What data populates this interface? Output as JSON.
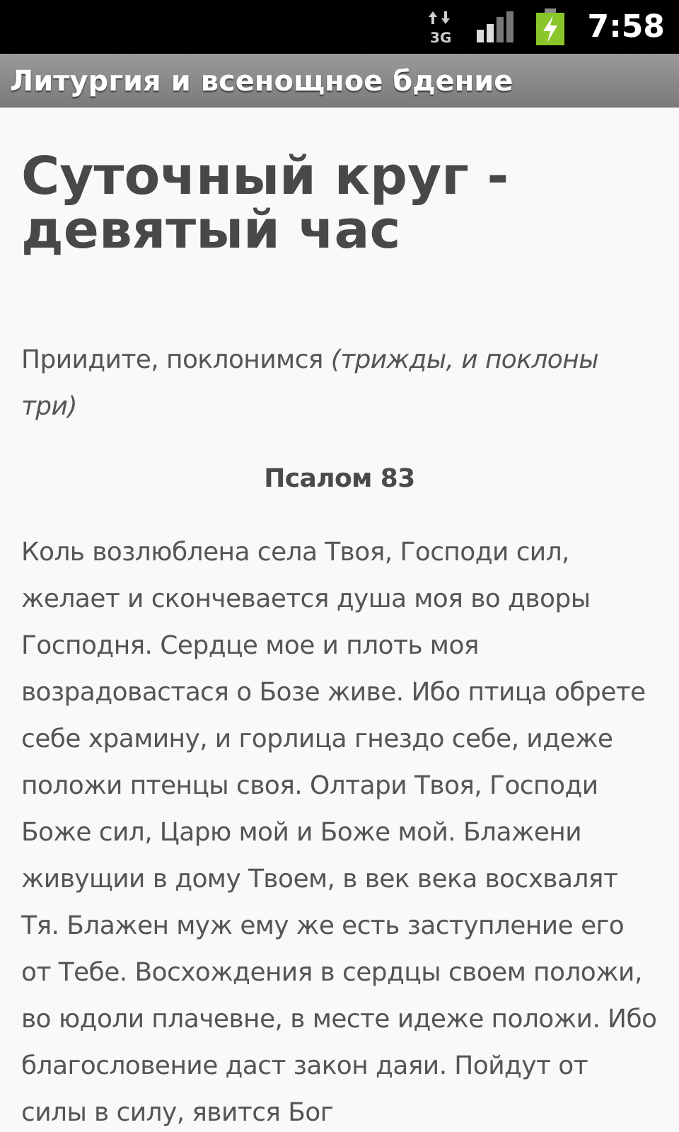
{
  "status_bar": {
    "network": "3G",
    "time": "7:58"
  },
  "title_bar": {
    "title": "Литургия и всенощное бдение"
  },
  "content": {
    "heading": "Суточный круг - девятый час",
    "intro": "Приидите, поклонимся *(трижды, и поклоны три)*",
    "section_title": "Псалом 83",
    "paragraph": "Коль возлюблена села Твоя, Господи сил, желает и скончевается душа моя во дворы Господня. Сердце мое и плоть моя возрадовастася о Бозе живе. Ибо птица обрете себе храмину, и горлица гнездо себе, идеже положи птенцы своя. Олтари Твоя, Господи Боже сил, Царю мой и Боже мой. Блажени живущии в дому Твоем, в век века восхвалят Тя. Блажен муж ему же есть заступление его от Тебе. Восхождения в сердцы своем положи, во юдоли плачевне, в месте идеже положи. Ибо благословение даст закон даяи. Пойдут от силы в силу, явится Бог"
  }
}
